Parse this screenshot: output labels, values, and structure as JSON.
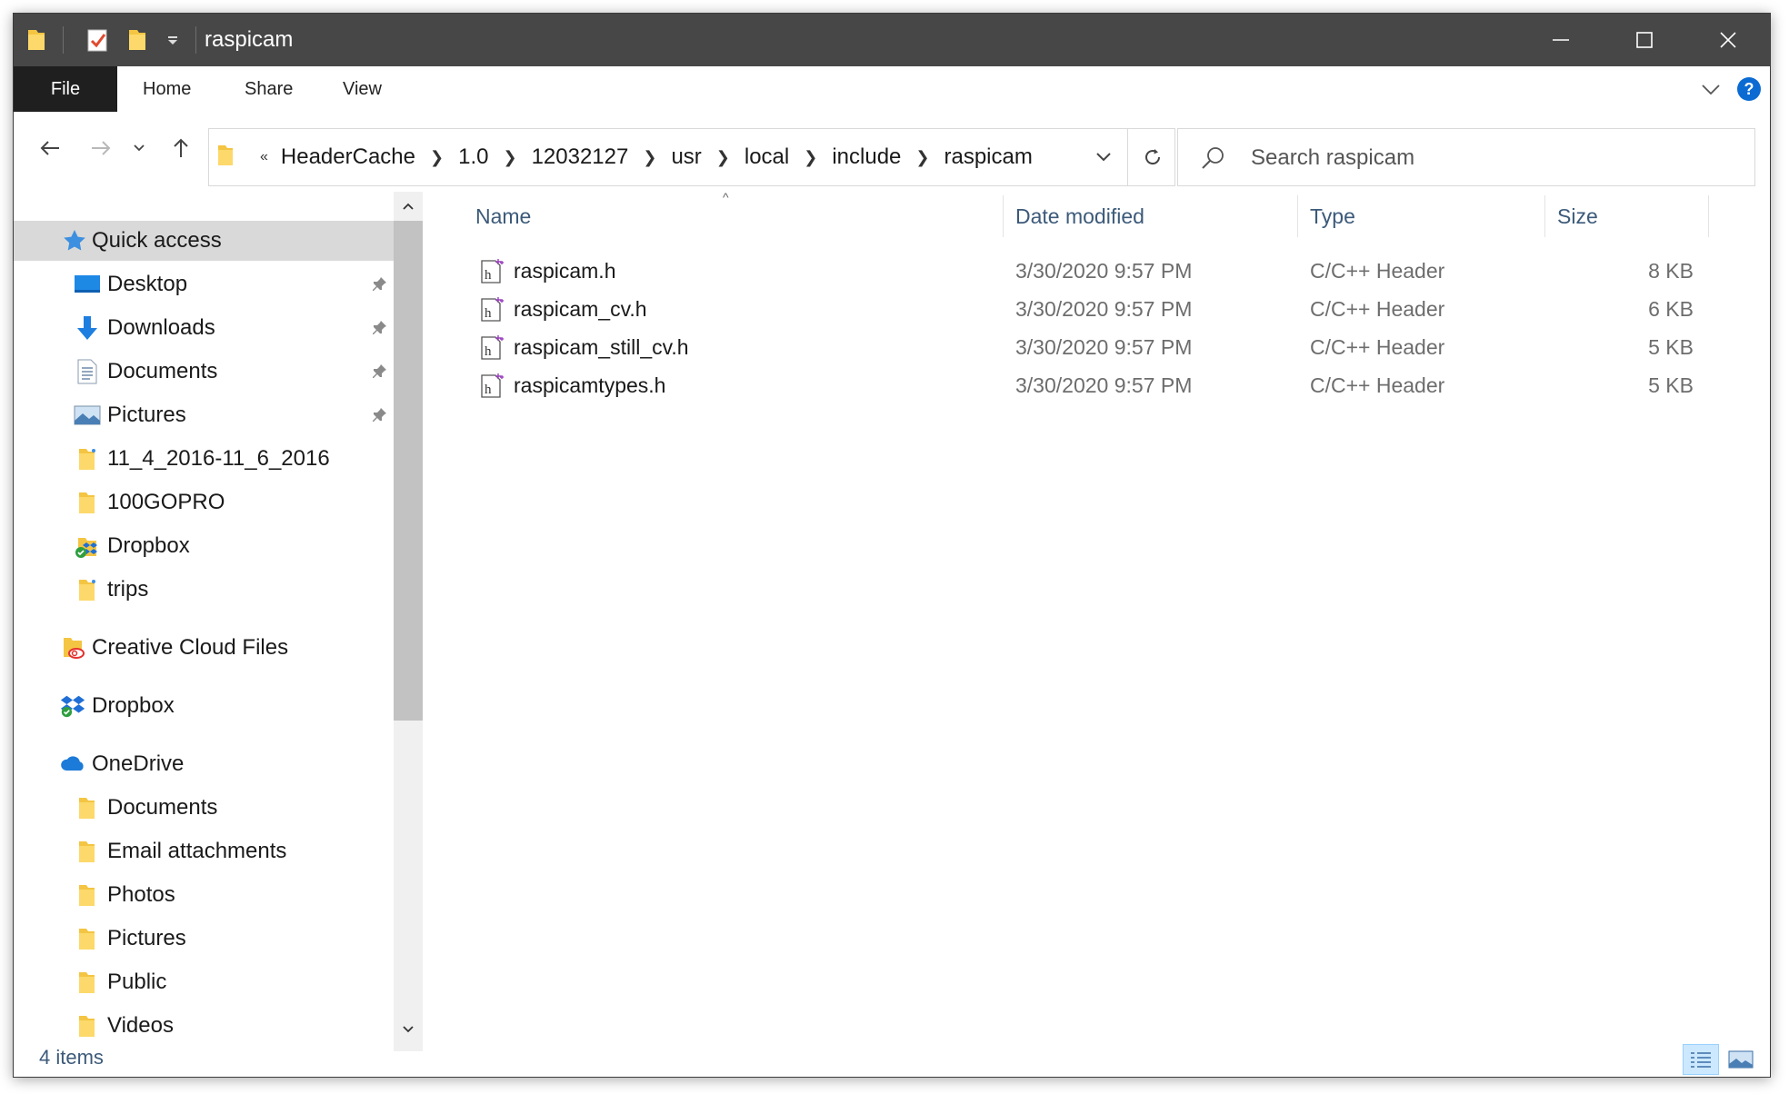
{
  "window": {
    "title": "raspicam"
  },
  "ribbon": {
    "tabs": [
      "File",
      "Home",
      "Share",
      "View"
    ],
    "help_label": "?"
  },
  "address": {
    "overflow": "«",
    "crumbs": [
      "HeaderCache",
      "1.0",
      "12032127",
      "usr",
      "local",
      "include",
      "raspicam"
    ]
  },
  "search": {
    "placeholder": "Search raspicam"
  },
  "sidebar": {
    "items": [
      {
        "label": "Quick access",
        "icon": "star-icon"
      },
      {
        "label": "Desktop",
        "icon": "desktop-icon",
        "pinned": true
      },
      {
        "label": "Downloads",
        "icon": "download-arrow-icon",
        "pinned": true
      },
      {
        "label": "Documents",
        "icon": "document-icon",
        "pinned": true
      },
      {
        "label": "Pictures",
        "icon": "pictures-icon",
        "pinned": true
      },
      {
        "label": "11_4_2016-11_6_2016",
        "icon": "folder-icon"
      },
      {
        "label": "100GOPRO",
        "icon": "folder-icon"
      },
      {
        "label": "Dropbox",
        "icon": "dropbox-folder-icon"
      },
      {
        "label": "trips",
        "icon": "folder-icon"
      },
      {
        "label": "Creative Cloud Files",
        "icon": "creative-cloud-icon"
      },
      {
        "label": "Dropbox",
        "icon": "dropbox-icon"
      },
      {
        "label": "OneDrive",
        "icon": "onedrive-cloud-icon"
      },
      {
        "label": "Documents",
        "icon": "folder-icon"
      },
      {
        "label": "Email attachments",
        "icon": "folder-icon"
      },
      {
        "label": "Photos",
        "icon": "folder-icon"
      },
      {
        "label": "Pictures",
        "icon": "folder-icon"
      },
      {
        "label": "Public",
        "icon": "folder-icon"
      },
      {
        "label": "Videos",
        "icon": "folder-icon"
      }
    ]
  },
  "file_list": {
    "columns": [
      "Name",
      "Date modified",
      "Type",
      "Size"
    ],
    "sort_indicator": "^",
    "rows": [
      {
        "name": "raspicam.h",
        "date": "3/30/2020 9:57 PM",
        "type": "C/C++ Header",
        "size": "8 KB"
      },
      {
        "name": "raspicam_cv.h",
        "date": "3/30/2020 9:57 PM",
        "type": "C/C++ Header",
        "size": "6 KB"
      },
      {
        "name": "raspicam_still_cv.h",
        "date": "3/30/2020 9:57 PM",
        "type": "C/C++ Header",
        "size": "5 KB"
      },
      {
        "name": "raspicamtypes.h",
        "date": "3/30/2020 9:57 PM",
        "type": "C/C++ Header",
        "size": "5 KB"
      }
    ]
  },
  "status": {
    "item_count": "4 items"
  },
  "colors": {
    "title_bar": "#474747",
    "file_tab": "#1f1f1f",
    "selected_nav": "#d9d9d9",
    "accent_blue": "#0b6bd3",
    "folder_yellow": "#f4c542"
  }
}
